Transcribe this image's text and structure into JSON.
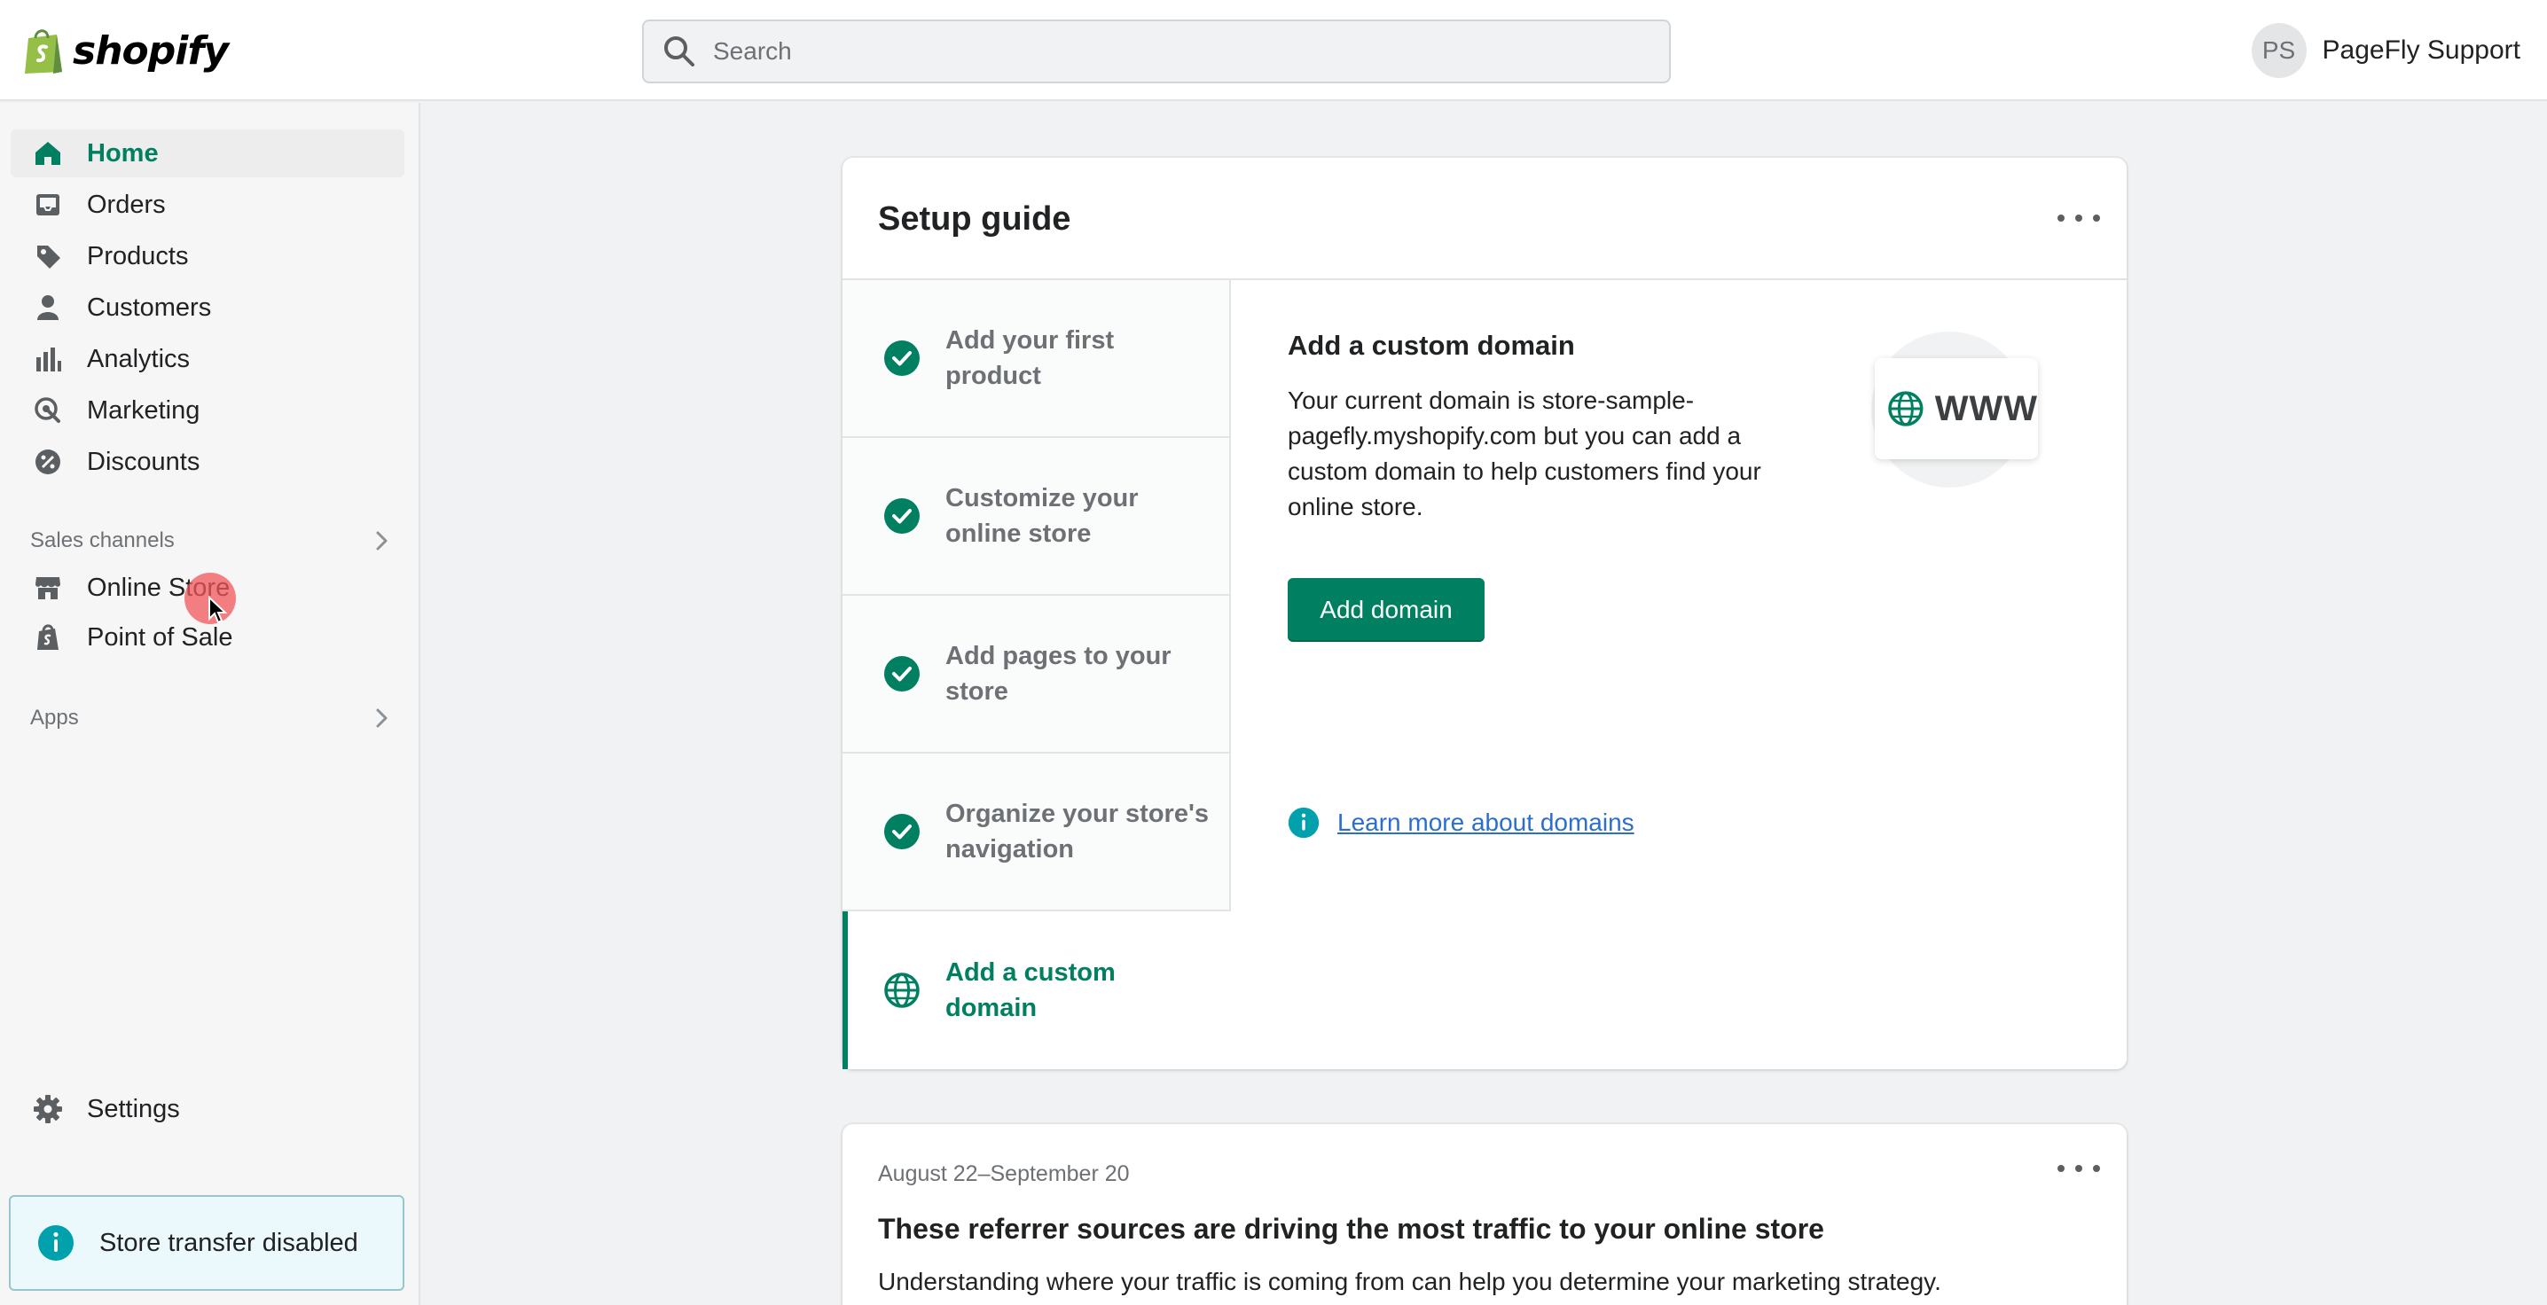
{
  "topbar": {
    "brand": "shopify",
    "search_placeholder": "Search",
    "user_initials": "PS",
    "user_name": "PageFly Support"
  },
  "sidebar": {
    "items": [
      {
        "label": "Home",
        "icon": "home-icon",
        "active": true
      },
      {
        "label": "Orders",
        "icon": "inbox-icon"
      },
      {
        "label": "Products",
        "icon": "tag-icon"
      },
      {
        "label": "Customers",
        "icon": "person-icon"
      },
      {
        "label": "Analytics",
        "icon": "bar-chart-icon"
      },
      {
        "label": "Marketing",
        "icon": "target-icon"
      },
      {
        "label": "Discounts",
        "icon": "discount-icon"
      }
    ],
    "sales_channels_label": "Sales channels",
    "channels": [
      {
        "label": "Online Store",
        "icon": "store-icon"
      },
      {
        "label": "Point of Sale",
        "icon": "pos-bag-icon"
      }
    ],
    "apps_label": "Apps",
    "settings_label": "Settings",
    "banner_text": "Store transfer disabled"
  },
  "setup_guide": {
    "title": "Setup guide",
    "steps": [
      {
        "label": "Add your first product",
        "done": true
      },
      {
        "label": "Customize your online store",
        "done": true
      },
      {
        "label": "Add pages to your store",
        "done": true
      },
      {
        "label": "Organize your store's navigation",
        "done": true
      },
      {
        "label": "Add a custom domain",
        "done": false,
        "current": true
      }
    ],
    "detail_title": "Add a custom domain",
    "detail_text": "Your current domain is store-sample-pagefly.myshopify.com but you can add a custom domain to help customers find your online store.",
    "button_label": "Add domain",
    "illustration_text": "WWW",
    "learn_more": "Learn more about domains"
  },
  "traffic": {
    "date_range": "August 22–September 20",
    "title": "These referrer sources are driving the most traffic to your online store",
    "description": "Understanding where your traffic is coming from can help you determine your marketing strategy."
  },
  "colors": {
    "accent": "#008060",
    "link": "#2c6ecb",
    "info": "#00a0ac",
    "cursor_highlight": "#f2555a"
  }
}
